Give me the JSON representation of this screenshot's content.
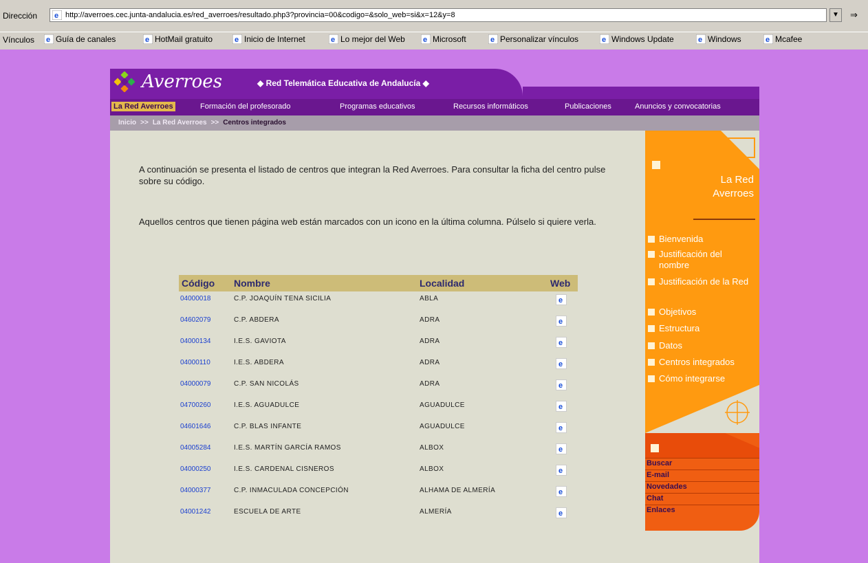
{
  "browser": {
    "address_label": "Dirección",
    "url": "http://averroes.cec.junta-andalucia.es/red_averroes/resultado.php3?provincia=00&codigo=&solo_web=si&x=12&y=8",
    "go_label": "Ir",
    "links_label": "Vínculos",
    "links": [
      "Guía de canales",
      "HotMail gratuito",
      "Inicio de Internet",
      "Lo mejor del Web",
      "Microsoft",
      "Personalizar vínculos",
      "Windows Update",
      "Windows",
      "Mcafee"
    ]
  },
  "site": {
    "logo": "Averroes",
    "tagline": "◆ Red Telemática Educativa de Andalucía ◆",
    "nav": [
      "La Red Averroes",
      "Formación del profesorado",
      "Programas educativos",
      "Recursos informáticos",
      "Publicaciones",
      "Anuncios y convocatorias"
    ],
    "breadcrumb": {
      "home": "Inicio",
      "sep": ">>",
      "section": "La Red Averroes",
      "current": "Centros integrados"
    }
  },
  "main": {
    "intro_1": "A continuación se presenta el listado de centros que integran la Red Averroes. Para consultar la ficha del centro pulse sobre su código.",
    "intro_2": "Aquellos centros que tienen página web están marcados con un icono en la última columna. Púlselo si quiere verla.",
    "table": {
      "headers": {
        "code": "Código",
        "name": "Nombre",
        "locality": "Localidad",
        "web": "Web"
      },
      "rows": [
        {
          "code": "04000018",
          "name": "C.P. JOAQUÍN TENA SICILIA",
          "locality": "ABLA"
        },
        {
          "code": "04602079",
          "name": "C.P. ABDERA",
          "locality": "ADRA"
        },
        {
          "code": "04000134",
          "name": "I.E.S. GAVIOTA",
          "locality": "ADRA"
        },
        {
          "code": "04000110",
          "name": "I.E.S. ABDERA",
          "locality": "ADRA"
        },
        {
          "code": "04000079",
          "name": "C.P. SAN NICOLÁS",
          "locality": "ADRA"
        },
        {
          "code": "04700260",
          "name": "I.E.S. AGUADULCE",
          "locality": "AGUADULCE"
        },
        {
          "code": "04601646",
          "name": "C.P. BLAS INFANTE",
          "locality": "AGUADULCE"
        },
        {
          "code": "04005284",
          "name": "I.E.S. MARTÍN GARCÍA RAMOS",
          "locality": "ALBOX"
        },
        {
          "code": "04000250",
          "name": "I.E.S. CARDENAL CISNEROS",
          "locality": "ALBOX"
        },
        {
          "code": "04000377",
          "name": "C.P. INMACULADA CONCEPCIÓN",
          "locality": "ALHAMA DE ALMERÍA"
        },
        {
          "code": "04001242",
          "name": "ESCUELA DE ARTE",
          "locality": "ALMERÍA"
        }
      ]
    }
  },
  "sidebar": {
    "title_line1": "La Red",
    "title_line2": "Averroes",
    "items": [
      "Bienvenida",
      "Justificación del nombre",
      "Justificación de la Red",
      "Objetivos",
      "Estructura",
      "Datos",
      "Centros integrados",
      "Cómo integrarse"
    ],
    "links": [
      "Buscar",
      "E-mail",
      "Novedades",
      "Chat",
      "Enlaces"
    ]
  },
  "colors": {
    "page_bg": "#c97be8",
    "purple": "#7a1ea6",
    "orange": "#ff9a10",
    "content_bg": "#deded0",
    "link_blue": "#1a3fcf"
  }
}
